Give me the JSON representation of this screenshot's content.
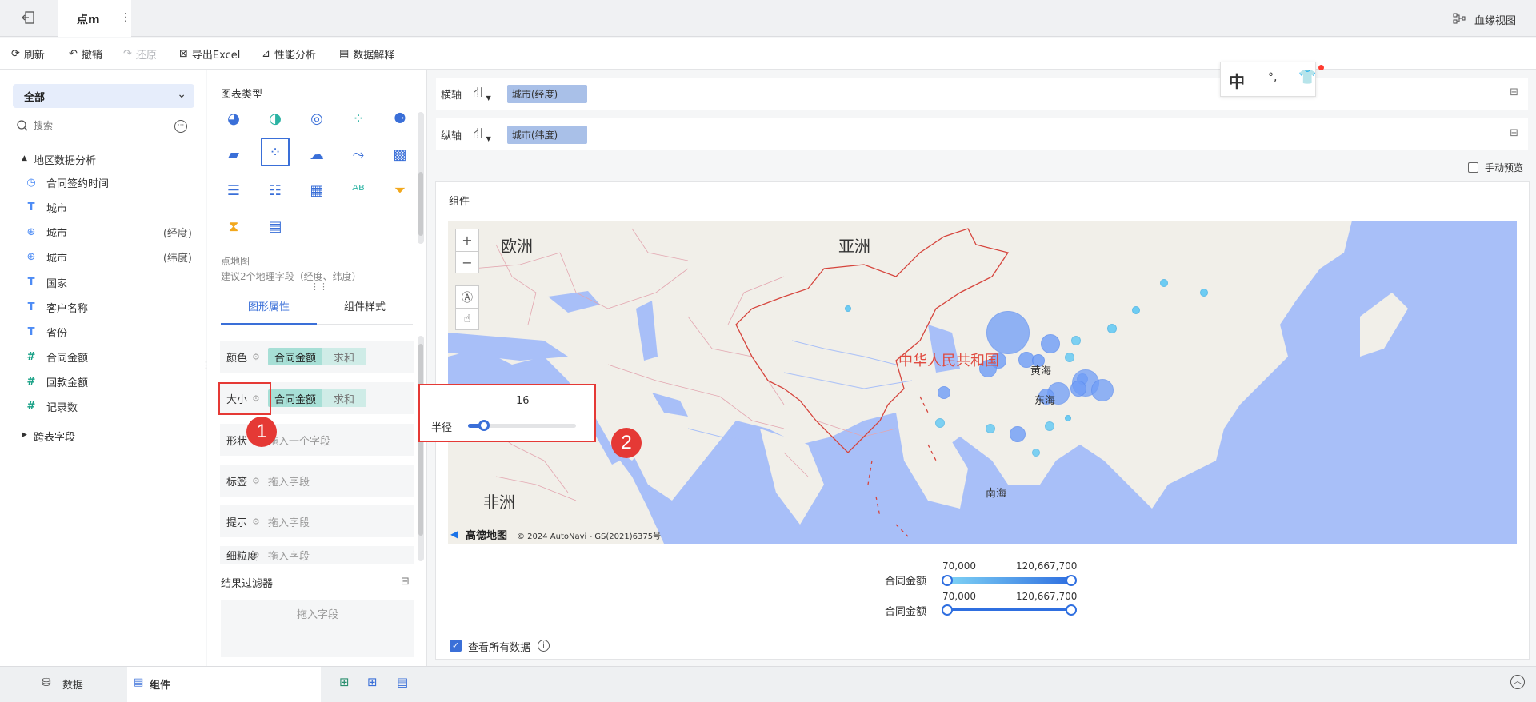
{
  "topbar": {
    "tab_title": "点m",
    "more": "⋮",
    "lineage_label": "血缘视图"
  },
  "toolbar": {
    "refresh": "刷新",
    "undo": "撤销",
    "redo": "还原",
    "export_excel": "导出Excel",
    "perf_analysis": "性能分析",
    "data_explain": "数据解释"
  },
  "ime": {
    "char": "中"
  },
  "left": {
    "dropdown_value": "全部",
    "search_placeholder": "搜索",
    "group_title": "地区数据分析",
    "fields": [
      {
        "label": "合同签约时间",
        "suffix": "",
        "type": "time"
      },
      {
        "label": "城市",
        "suffix": "",
        "type": "text"
      },
      {
        "label": "城市",
        "suffix": "(经度)",
        "type": "geo"
      },
      {
        "label": "城市",
        "suffix": "(纬度)",
        "type": "geo"
      },
      {
        "label": "国家",
        "suffix": "",
        "type": "text"
      },
      {
        "label": "客户名称",
        "suffix": "",
        "type": "text"
      },
      {
        "label": "省份",
        "suffix": "",
        "type": "text"
      },
      {
        "label": "合同金额",
        "suffix": "",
        "type": "num"
      },
      {
        "label": "回款金额",
        "suffix": "",
        "type": "num"
      },
      {
        "label": "记录数",
        "suffix": "",
        "type": "num"
      }
    ],
    "cross_table": "跨表字段"
  },
  "middle": {
    "chart_type_title": "图表类型",
    "chart_desc_title": "点地图",
    "chart_desc_hint": "建议2个地理字段（经度、纬度）",
    "tab_graph_attr": "图形属性",
    "tab_component_style": "组件样式",
    "props": [
      {
        "label": "颜色",
        "field": "合同金额",
        "agg": "求和",
        "placeholder": ""
      },
      {
        "label": "大小",
        "field": "合同金额",
        "agg": "求和",
        "placeholder": ""
      },
      {
        "label": "形状",
        "field": "",
        "agg": "",
        "placeholder": "拖入一个字段"
      },
      {
        "label": "标签",
        "field": "",
        "agg": "",
        "placeholder": "拖入字段"
      },
      {
        "label": "提示",
        "field": "",
        "agg": "",
        "placeholder": "拖入字段"
      },
      {
        "label": "细粒度",
        "field": "",
        "agg": "",
        "placeholder": "拖入字段"
      }
    ],
    "result_filter_title": "结果过滤器",
    "result_filter_placeholder": "拖入字段"
  },
  "popup": {
    "value": "16",
    "radius_label": "半径",
    "slider_fraction": 0.15
  },
  "badges": {
    "one": "1",
    "two": "2"
  },
  "right": {
    "x_axis_label": "横轴",
    "x_axis_field": "城市(经度)",
    "y_axis_label": "纵轴",
    "y_axis_field": "城市(纬度)",
    "manual_preview": "手动预览",
    "component_title": "组件",
    "map": {
      "labels": {
        "europe": "欧洲",
        "asia": "亚洲",
        "africa": "非洲",
        "china": "中华人民共和国",
        "yellow_sea": "黄海",
        "east_sea": "东海",
        "south_sea": "南海"
      },
      "attribution": "高德地图",
      "copyright": "© 2024 AutoNavi - GS(2021)6375号",
      "zoom_in": "+",
      "zoom_out": "−"
    },
    "legends": [
      {
        "label": "合同金额",
        "min": "70,000",
        "max": "120,667,700",
        "kind": "color"
      },
      {
        "label": "合同金额",
        "min": "70,000",
        "max": "120,667,700",
        "kind": "size"
      }
    ],
    "view_all_data": "查看所有数据"
  },
  "bottom": {
    "tab_data": "数据",
    "tab_component": "组件"
  },
  "colors": {
    "accent": "#3a6fd8",
    "highlight_red": "#e53935",
    "map_sea": "#a8bff8",
    "map_land": "#f1efe9",
    "bubble": "#6f9df7",
    "pill_green": "#a7dfd6",
    "pill_blue": "#a9c0e8"
  }
}
